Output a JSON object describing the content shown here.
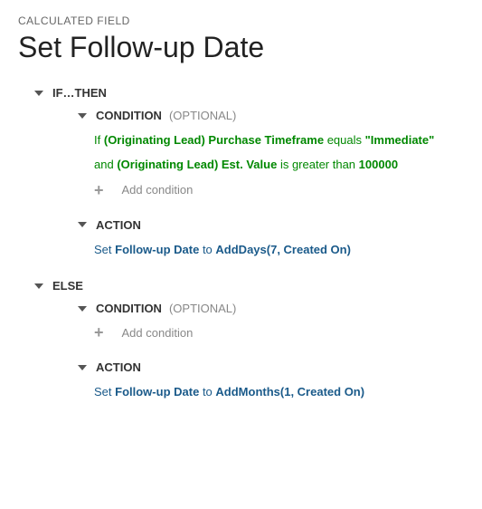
{
  "breadcrumb": "CALCULATED FIELD",
  "title": "Set Follow-up Date",
  "ifthen": {
    "label": "IF…THEN",
    "condition": {
      "label": "CONDITION",
      "optional": "(OPTIONAL)",
      "rows": [
        {
          "kw": "If",
          "field": "(Originating Lead) Purchase Timeframe",
          "op": "equals",
          "val": "\"Immediate\""
        },
        {
          "kw": "and",
          "field": "(Originating Lead) Est. Value",
          "op": "is greater than",
          "val": "100000"
        }
      ],
      "add_label": "Add condition"
    },
    "action": {
      "label": "ACTION",
      "kw1": "Set",
      "field": "Follow-up Date",
      "kw2": "to",
      "func": "AddDays(7, Created On)"
    }
  },
  "else": {
    "label": "ELSE",
    "condition": {
      "label": "CONDITION",
      "optional": "(OPTIONAL)",
      "add_label": "Add condition"
    },
    "action": {
      "label": "ACTION",
      "kw1": "Set",
      "field": "Follow-up Date",
      "kw2": "to",
      "func": "AddMonths(1, Created On)"
    }
  }
}
